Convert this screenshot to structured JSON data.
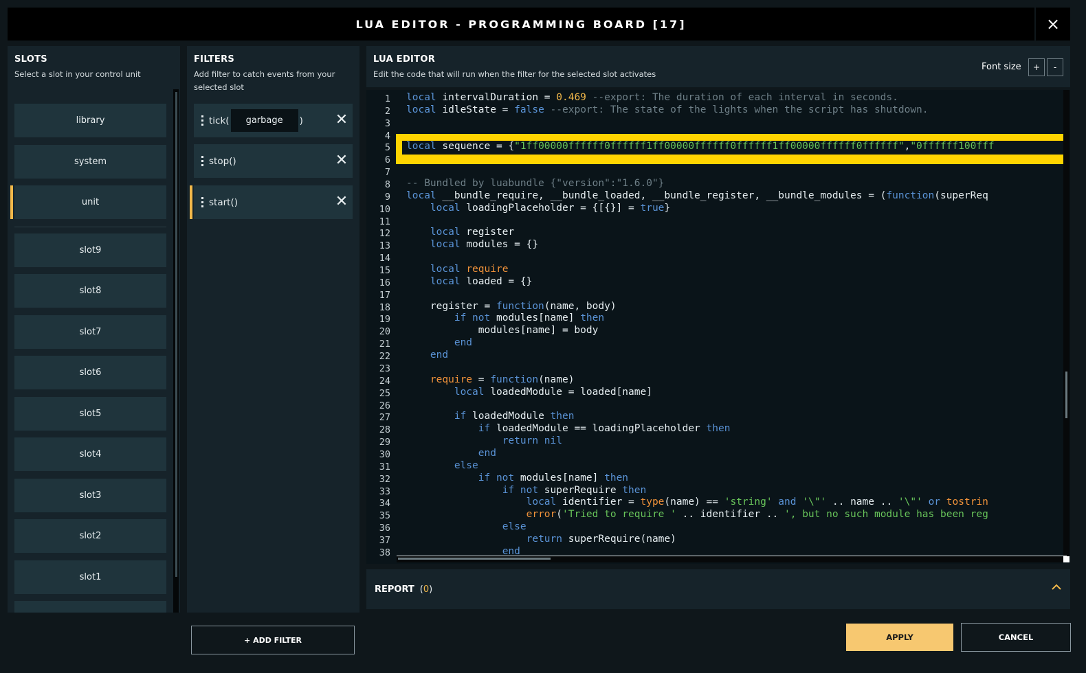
{
  "window": {
    "title": "LUA EDITOR - PROGRAMMING BOARD [17]",
    "close_icon": "×"
  },
  "slots": {
    "title": "SLOTS",
    "subtitle": "Select a slot in your control unit",
    "items": [
      {
        "label": "library"
      },
      {
        "label": "system"
      },
      {
        "label": "unit",
        "active": true
      },
      {
        "label": "slot9"
      },
      {
        "label": "slot8"
      },
      {
        "label": "slot7"
      },
      {
        "label": "slot6"
      },
      {
        "label": "slot5"
      },
      {
        "label": "slot4"
      },
      {
        "label": "slot3"
      },
      {
        "label": "slot2"
      },
      {
        "label": "slot1"
      }
    ]
  },
  "filters": {
    "title": "FILTERS",
    "subtitle_1": "Add filter to catch events from your",
    "subtitle_2": "selected slot",
    "items": [
      {
        "prefix": "tick(",
        "arg": "garbage",
        "suffix": ")"
      },
      {
        "label": "stop()"
      },
      {
        "label": "start()",
        "active": true
      }
    ],
    "add_label": "+ ADD FILTER"
  },
  "editor": {
    "title": "LUA EDITOR",
    "subtitle": "Edit the code that will run when the filter for the selected slot activates",
    "font_size_label": "Font size",
    "font_plus": "+",
    "font_minus": "-",
    "line_numbers": [
      "1",
      "2",
      "3",
      "4",
      "5",
      "6",
      "7",
      "8",
      "9",
      "10",
      "11",
      "12",
      "13",
      "14",
      "15",
      "16",
      "17",
      "18",
      "19",
      "20",
      "21",
      "22",
      "23",
      "24",
      "25",
      "26",
      "27",
      "28",
      "29",
      "30",
      "31",
      "32",
      "33",
      "34",
      "35",
      "36",
      "37",
      "38"
    ]
  },
  "report": {
    "label": "REPORT",
    "count": "0"
  },
  "actions": {
    "apply": "APPLY",
    "cancel": "CANCEL"
  },
  "colors": {
    "accent": "#f2b84a",
    "highlight": "#ffd400",
    "keyword": "#5a93d6",
    "string": "#68c45a",
    "number": "#f2b84a",
    "comment": "#6e7f87"
  }
}
